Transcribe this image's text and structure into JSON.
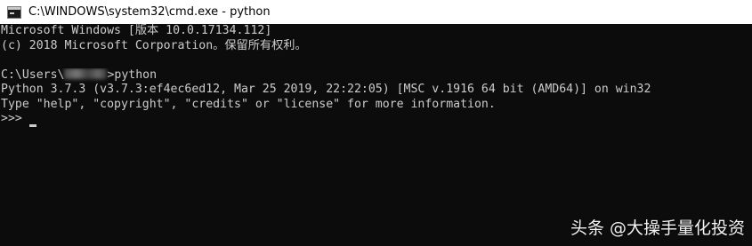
{
  "window": {
    "title": "C:\\WINDOWS\\system32\\cmd.exe - python",
    "app_icon": "cmd-icon",
    "colors": {
      "console_background": "#0c0c0c",
      "console_text": "#cccccc",
      "titlebar_background": "#ffffff"
    }
  },
  "console": {
    "line1": "Microsoft Windows [版本 10.0.17134.112]",
    "line2": "(c) 2018 Microsoft Corporation。保留所有权利。",
    "line3": "",
    "line4_prefix": "C:\\Users\\",
    "line4_suffix": ">python",
    "line5": "Python 3.7.3 (v3.7.3:ef4ec6ed12, Mar 25 2019, 22:22:05) [MSC v.1916 64 bit (AMD64)] on win32",
    "line6": "Type \"help\", \"copyright\", \"credits\" or \"license\" for more information.",
    "line7": ">>> "
  },
  "watermark": {
    "text": "头条 @大操手量化投资"
  }
}
